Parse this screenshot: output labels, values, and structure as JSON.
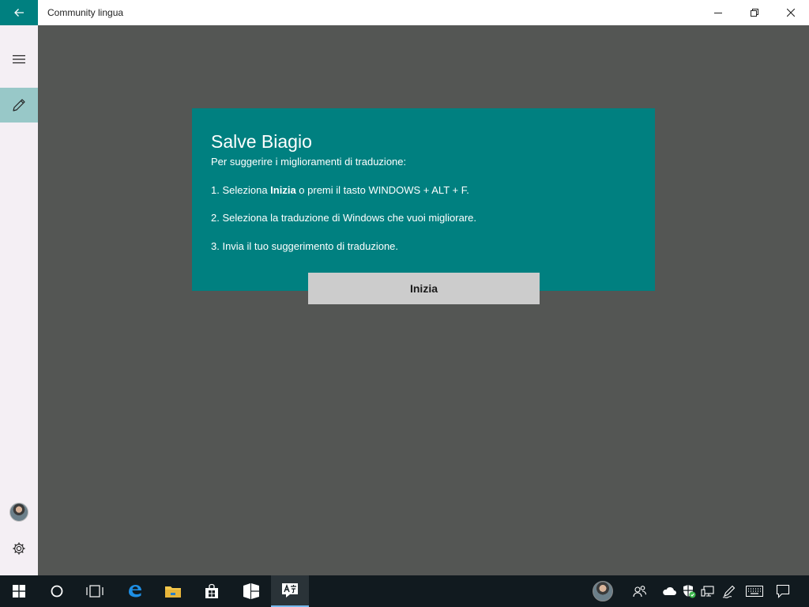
{
  "window": {
    "title": "Community lingua"
  },
  "card": {
    "greeting": "Salve Biagio",
    "intro": "Per suggerire i miglioramenti di traduzione:",
    "step1_before": "1. Seleziona ",
    "step1_bold": "Inizia",
    "step1_after": " o premi il tasto WINDOWS + ALT + F.",
    "step2": "2. Seleziona la traduzione di Windows che vuoi migliorare.",
    "step3": "3. Invia il tuo suggerimento di traduzione.",
    "start_button": "Inizia"
  },
  "icons": {
    "back": "back-arrow-icon",
    "minimize": "minimize-icon",
    "maximize": "restore-icon",
    "close": "close-icon",
    "menu": "hamburger-menu-icon",
    "edit": "pencil-icon",
    "settings": "gear-icon"
  },
  "colors": {
    "accent": "#008080",
    "content_bg": "#545654",
    "nav_bg": "#f4eff4",
    "nav_selected": "#98c8c8",
    "button_bg": "#cccccc",
    "taskbar_bg": "#111a1f"
  }
}
